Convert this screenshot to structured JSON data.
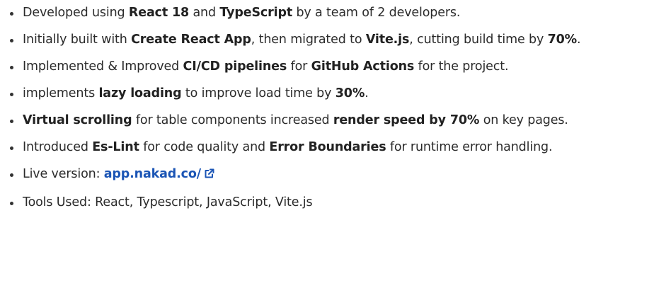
{
  "bullets": [
    {
      "parts": [
        {
          "t": "Developed using "
        },
        {
          "t": "React 18",
          "b": true
        },
        {
          "t": " and "
        },
        {
          "t": "TypeScript",
          "b": true
        },
        {
          "t": " by a team of 2 developers."
        }
      ]
    },
    {
      "parts": [
        {
          "t": "Initially built with "
        },
        {
          "t": "Create React App",
          "b": true
        },
        {
          "t": ", then migrated to "
        },
        {
          "t": "Vite.js",
          "b": true
        },
        {
          "t": ", cutting build time by "
        },
        {
          "t": "70%",
          "b": true
        },
        {
          "t": "."
        }
      ]
    },
    {
      "parts": [
        {
          "t": "Implemented & Improved "
        },
        {
          "t": "CI/CD pipelines",
          "b": true
        },
        {
          "t": " for "
        },
        {
          "t": "GitHub Actions",
          "b": true
        },
        {
          "t": " for the project."
        }
      ]
    },
    {
      "parts": [
        {
          "t": "implements "
        },
        {
          "t": "lazy loading",
          "b": true
        },
        {
          "t": " to improve load time by "
        },
        {
          "t": "30%",
          "b": true
        },
        {
          "t": "."
        }
      ]
    },
    {
      "parts": [
        {
          "t": "Virtual scrolling",
          "b": true
        },
        {
          "t": " for table components increased "
        },
        {
          "t": "render speed by 70%",
          "b": true
        },
        {
          "t": " on key pages."
        }
      ]
    },
    {
      "parts": [
        {
          "t": "Introduced "
        },
        {
          "t": "Es-Lint",
          "b": true
        },
        {
          "t": " for code quality and "
        },
        {
          "t": "Error Boundaries",
          "b": true
        },
        {
          "t": " for runtime error handling."
        }
      ]
    },
    {
      "parts": [
        {
          "t": "Live version: "
        },
        {
          "t": "app.nakad.co/",
          "link": true,
          "icon": "external-link-icon"
        }
      ]
    },
    {
      "parts": [
        {
          "t": "Tools Used: React, Typescript, JavaScript, Vite.js"
        }
      ]
    }
  ],
  "colors": {
    "text": "#2b2b2b",
    "bold": "#222222",
    "link": "#1b55b5",
    "bullet": "#333333"
  }
}
